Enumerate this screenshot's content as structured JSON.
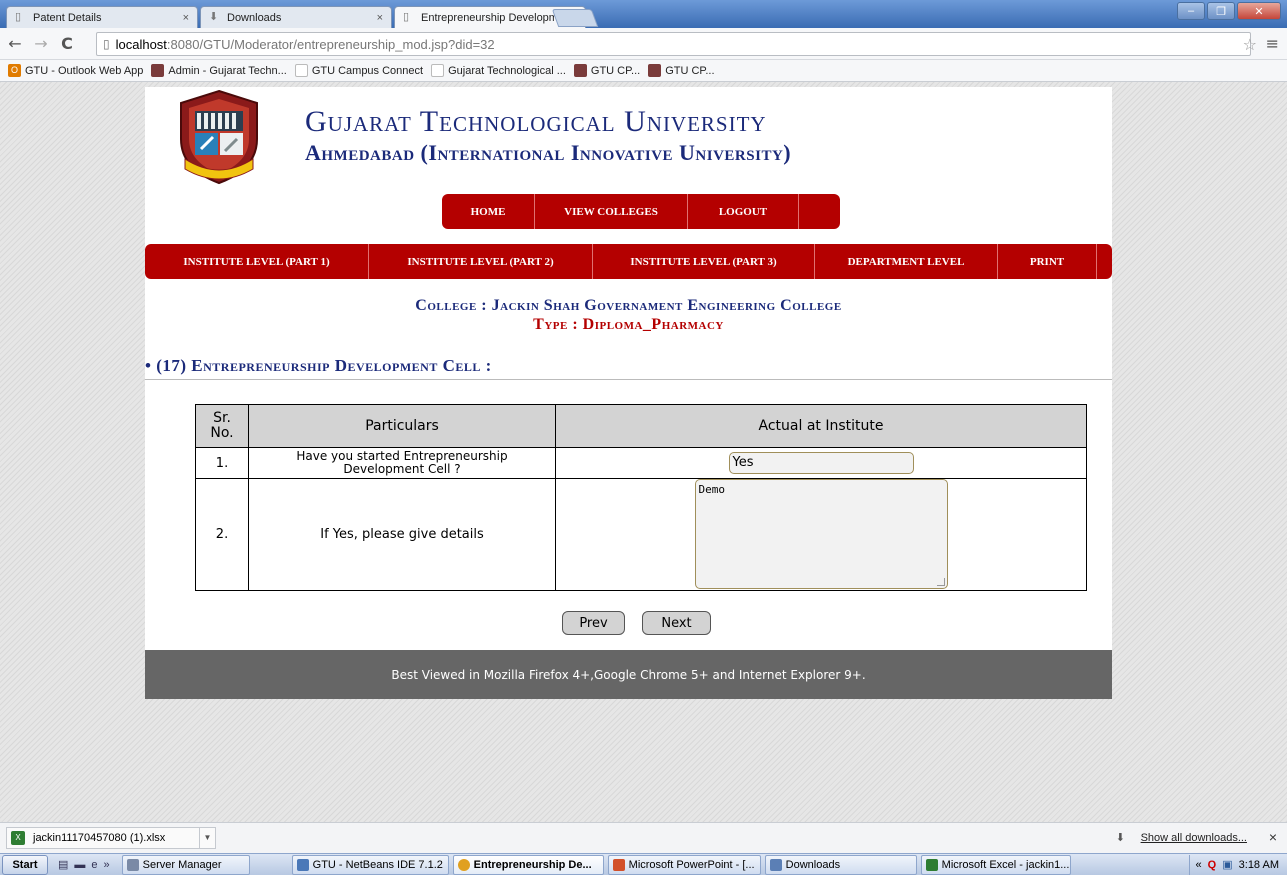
{
  "browser": {
    "tabs": [
      {
        "label": "Patent Details",
        "close": "×"
      },
      {
        "label": "Downloads",
        "close": "×"
      },
      {
        "label": "Entrepreneurship Developme",
        "close": "×"
      }
    ],
    "address": {
      "host": "localhost",
      "path": ":8080/GTU/Moderator/entrepreneurship_mod.jsp?did=32"
    },
    "bookmarks": [
      "GTU - Outlook Web App",
      "Admin - Gujarat Techn...",
      "GTU Campus Connect",
      "Gujarat Technological ...",
      "GTU CP...",
      "GTU CP..."
    ]
  },
  "header": {
    "university": "Gujarat Technological University",
    "subtitle": "Ahmedabad (International Innovative University)"
  },
  "top_nav": [
    "HOME",
    "VIEW COLLEGES",
    "LOGOUT"
  ],
  "sub_nav": [
    "INSTITUTE LEVEL (PART 1)",
    "INSTITUTE LEVEL (PART 2)",
    "INSTITUTE LEVEL (PART 3)",
    "DEPARTMENT LEVEL",
    "PRINT"
  ],
  "college": "College : Jackin Shah Governament Engineering College",
  "type": "Type : Diploma_Pharmacy",
  "section_title": "• (17) Entrepreneurship Development Cell :",
  "table": {
    "headers": [
      "Sr.\nNo.",
      "Particulars",
      "Actual at Institute"
    ],
    "rows": [
      {
        "sr": "1.",
        "particular": "Have you started Entrepreneurship Development Cell ?",
        "value": "Yes"
      },
      {
        "sr": "2.",
        "particular": "If Yes, please give details",
        "value": "Demo"
      }
    ]
  },
  "buttons": {
    "prev": "Prev",
    "next": "Next"
  },
  "footer": "Best Viewed in Mozilla Firefox 4+,Google Chrome 5+ and Internet Explorer 9+.",
  "downloads": {
    "file": "jackin11170457080 (1).xlsx",
    "show_all": "Show all downloads...",
    "close": "×"
  },
  "taskbar": {
    "start": "Start",
    "items": [
      "Server Manager",
      "GTU - NetBeans IDE 7.1.2",
      "Entrepreneurship De...",
      "Microsoft PowerPoint - [...",
      "Downloads",
      "Microsoft Excel - jackin1..."
    ],
    "clock": "3:18 AM"
  },
  "colors": {
    "brand_red": "#b40000",
    "brand_blue": "#1b2a7a",
    "footer_gray": "#666666"
  }
}
